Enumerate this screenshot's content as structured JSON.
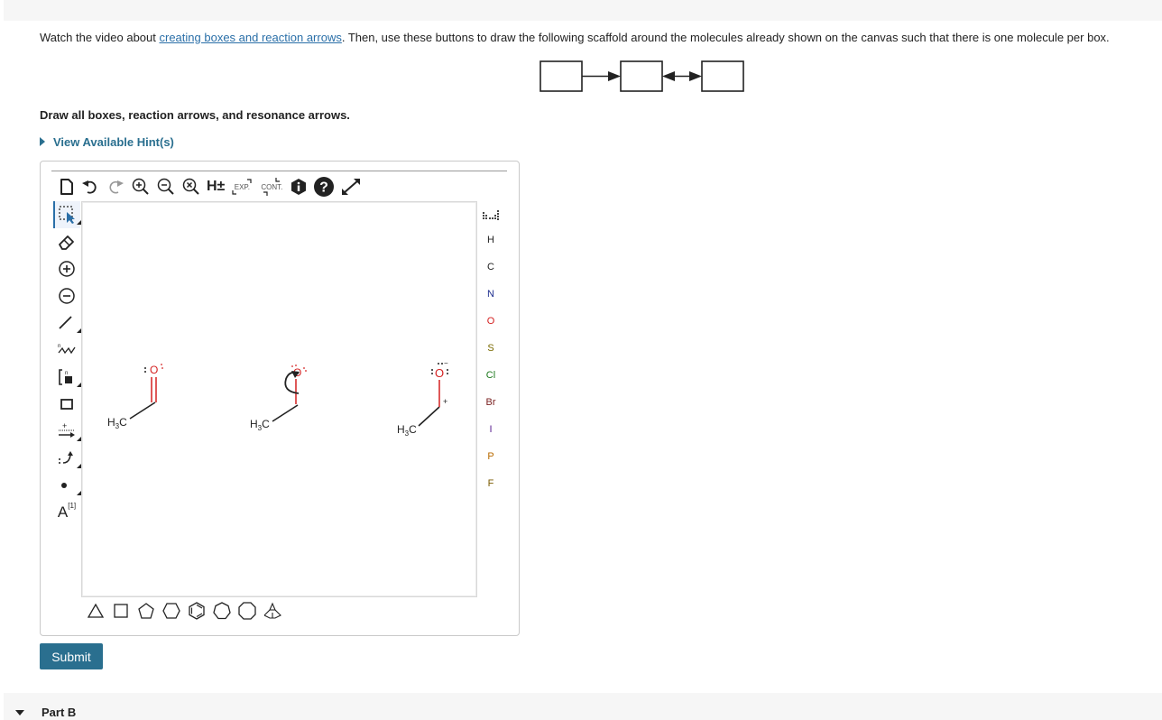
{
  "instructions": {
    "prefix": "Watch the video about ",
    "link_text": "creating boxes and reaction arrows",
    "suffix": ". Then, use these buttons to draw the following scaffold around the molecules already shown on the canvas such that there is one molecule per box."
  },
  "prompt": "Draw all boxes, reaction arrows, and resonance arrows.",
  "hint_link": "View Available Hint(s)",
  "toolbar": {
    "h_label": "H±",
    "exp_label": "EXP.",
    "cont_label": "CONT."
  },
  "left_tools": [
    {
      "name": "select-tool",
      "icon": "marquee-select-icon"
    },
    {
      "name": "eraser-tool",
      "icon": "eraser-icon"
    },
    {
      "name": "positive-charge-tool",
      "icon": "plus-circle-icon"
    },
    {
      "name": "negative-charge-tool",
      "icon": "minus-circle-icon"
    },
    {
      "name": "bond-tool",
      "icon": "bond-line-icon"
    },
    {
      "name": "chain-tool",
      "icon": "chain-icon"
    },
    {
      "name": "bracket-tool",
      "icon": "bracket-icon"
    },
    {
      "name": "box-tool",
      "icon": "box-icon"
    },
    {
      "name": "reaction-arrow-tool",
      "icon": "reaction-arrow-icon"
    },
    {
      "name": "curved-arrow-tool",
      "icon": "curved-arrow-icon"
    },
    {
      "name": "electron-dot-tool",
      "icon": "dot-icon"
    },
    {
      "name": "atom-label-tool",
      "icon": "atom-label-icon",
      "label": "A",
      "superscript": "[1]"
    }
  ],
  "elements": [
    {
      "symbol": "H",
      "color": "#222222"
    },
    {
      "symbol": "C",
      "color": "#222222"
    },
    {
      "symbol": "N",
      "color": "#1f2f8f"
    },
    {
      "symbol": "O",
      "color": "#d42020"
    },
    {
      "symbol": "S",
      "color": "#7a6a00"
    },
    {
      "symbol": "Cl",
      "color": "#1c7a1c"
    },
    {
      "symbol": "Br",
      "color": "#7a2020"
    },
    {
      "symbol": "I",
      "color": "#5a1f8f"
    },
    {
      "symbol": "P",
      "color": "#b86a00"
    },
    {
      "symbol": "F",
      "color": "#7a5a00"
    }
  ],
  "rings": [
    "triangle",
    "square",
    "pentagon",
    "hexagon",
    "benzene",
    "heptagon",
    "octagon",
    "chair"
  ],
  "molecules": {
    "methyl_label": "H3C",
    "oxygen": "O",
    "plus": "+",
    "minus": "−"
  },
  "colors": {
    "accent": "#2a6f8f",
    "link": "#2a6fa8",
    "oxygen": "#d42020"
  },
  "submit_label": "Submit",
  "part_b_label": "Part B"
}
